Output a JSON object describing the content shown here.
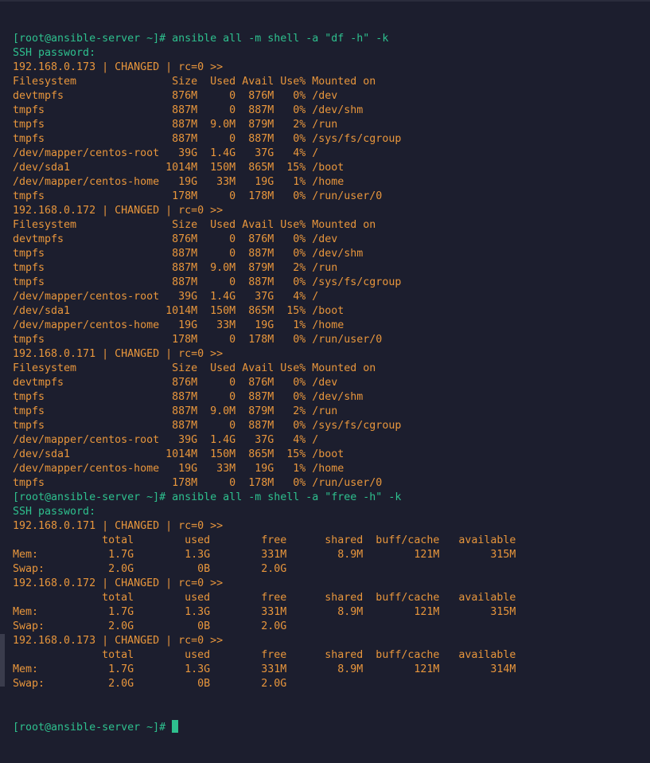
{
  "terminal": {
    "colors": {
      "background": "#1c1e2e",
      "prompt": "#2ec08e",
      "output": "#e8963c"
    },
    "lines": [
      {
        "kind": "prompt",
        "text": "[root@ansible-server ~]# ansible all -m shell -a \"df -h\" -k"
      },
      {
        "kind": "info",
        "text": "SSH password:"
      },
      {
        "kind": "output",
        "text": "192.168.0.173 | CHANGED | rc=0 >>"
      },
      {
        "kind": "output",
        "text": "Filesystem               Size  Used Avail Use% Mounted on"
      },
      {
        "kind": "output",
        "text": "devtmpfs                 876M     0  876M   0% /dev"
      },
      {
        "kind": "output",
        "text": "tmpfs                    887M     0  887M   0% /dev/shm"
      },
      {
        "kind": "output",
        "text": "tmpfs                    887M  9.0M  879M   2% /run"
      },
      {
        "kind": "output",
        "text": "tmpfs                    887M     0  887M   0% /sys/fs/cgroup"
      },
      {
        "kind": "output",
        "text": "/dev/mapper/centos-root   39G  1.4G   37G   4% /"
      },
      {
        "kind": "output",
        "text": "/dev/sda1               1014M  150M  865M  15% /boot"
      },
      {
        "kind": "output",
        "text": "/dev/mapper/centos-home   19G   33M   19G   1% /home"
      },
      {
        "kind": "output",
        "text": "tmpfs                    178M     0  178M   0% /run/user/0"
      },
      {
        "kind": "output",
        "text": "192.168.0.172 | CHANGED | rc=0 >>"
      },
      {
        "kind": "output",
        "text": "Filesystem               Size  Used Avail Use% Mounted on"
      },
      {
        "kind": "output",
        "text": "devtmpfs                 876M     0  876M   0% /dev"
      },
      {
        "kind": "output",
        "text": "tmpfs                    887M     0  887M   0% /dev/shm"
      },
      {
        "kind": "output",
        "text": "tmpfs                    887M  9.0M  879M   2% /run"
      },
      {
        "kind": "output",
        "text": "tmpfs                    887M     0  887M   0% /sys/fs/cgroup"
      },
      {
        "kind": "output",
        "text": "/dev/mapper/centos-root   39G  1.4G   37G   4% /"
      },
      {
        "kind": "output",
        "text": "/dev/sda1               1014M  150M  865M  15% /boot"
      },
      {
        "kind": "output",
        "text": "/dev/mapper/centos-home   19G   33M   19G   1% /home"
      },
      {
        "kind": "output",
        "text": "tmpfs                    178M     0  178M   0% /run/user/0"
      },
      {
        "kind": "output",
        "text": "192.168.0.171 | CHANGED | rc=0 >>"
      },
      {
        "kind": "output",
        "text": "Filesystem               Size  Used Avail Use% Mounted on"
      },
      {
        "kind": "output",
        "text": "devtmpfs                 876M     0  876M   0% /dev"
      },
      {
        "kind": "output",
        "text": "tmpfs                    887M     0  887M   0% /dev/shm"
      },
      {
        "kind": "output",
        "text": "tmpfs                    887M  9.0M  879M   2% /run"
      },
      {
        "kind": "output",
        "text": "tmpfs                    887M     0  887M   0% /sys/fs/cgroup"
      },
      {
        "kind": "output",
        "text": "/dev/mapper/centos-root   39G  1.4G   37G   4% /"
      },
      {
        "kind": "output",
        "text": "/dev/sda1               1014M  150M  865M  15% /boot"
      },
      {
        "kind": "output",
        "text": "/dev/mapper/centos-home   19G   33M   19G   1% /home"
      },
      {
        "kind": "output",
        "text": "tmpfs                    178M     0  178M   0% /run/user/0"
      },
      {
        "kind": "prompt",
        "text": "[root@ansible-server ~]# ansible all -m shell -a \"free -h\" -k"
      },
      {
        "kind": "info",
        "text": "SSH password:"
      },
      {
        "kind": "output",
        "text": "192.168.0.171 | CHANGED | rc=0 >>"
      },
      {
        "kind": "output",
        "text": "              total        used        free      shared  buff/cache   available"
      },
      {
        "kind": "output",
        "text": "Mem:           1.7G        1.3G        331M        8.9M        121M        315M"
      },
      {
        "kind": "output",
        "text": "Swap:          2.0G          0B        2.0G"
      },
      {
        "kind": "output",
        "text": "192.168.0.172 | CHANGED | rc=0 >>"
      },
      {
        "kind": "output",
        "text": "              total        used        free      shared  buff/cache   available"
      },
      {
        "kind": "output",
        "text": "Mem:           1.7G        1.3G        331M        8.9M        121M        315M"
      },
      {
        "kind": "output",
        "text": "Swap:          2.0G          0B        2.0G"
      },
      {
        "kind": "output",
        "text": "192.168.0.173 | CHANGED | rc=0 >>"
      },
      {
        "kind": "output",
        "text": "              total        used        free      shared  buff/cache   available"
      },
      {
        "kind": "output",
        "text": "Mem:           1.7G        1.3G        331M        8.9M        121M        314M"
      },
      {
        "kind": "output",
        "text": "Swap:          2.0G          0B        2.0G"
      }
    ],
    "current_prompt": "[root@ansible-server ~]# "
  }
}
